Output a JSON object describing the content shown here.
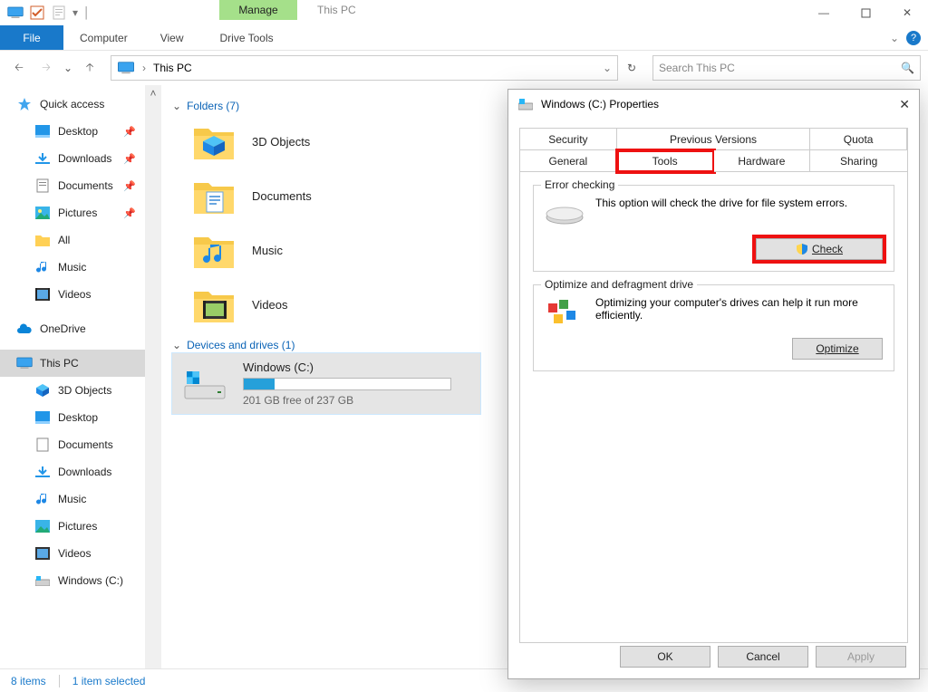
{
  "titlebar": {
    "title": "This PC",
    "context_tab": "Manage"
  },
  "ribbon": {
    "file": "File",
    "tabs": [
      "Computer",
      "View"
    ],
    "context_tab": "Drive Tools"
  },
  "address": {
    "location": "This PC"
  },
  "search": {
    "placeholder": "Search This PC"
  },
  "nav": {
    "quick_access": "Quick access",
    "qa_items": [
      {
        "label": "Desktop"
      },
      {
        "label": "Downloads"
      },
      {
        "label": "Documents"
      },
      {
        "label": "Pictures"
      },
      {
        "label": "All"
      },
      {
        "label": "Music"
      },
      {
        "label": "Videos"
      }
    ],
    "onedrive": "OneDrive",
    "this_pc": "This PC",
    "pc_items": [
      {
        "label": "3D Objects"
      },
      {
        "label": "Desktop"
      },
      {
        "label": "Documents"
      },
      {
        "label": "Downloads"
      },
      {
        "label": "Music"
      },
      {
        "label": "Pictures"
      },
      {
        "label": "Videos"
      },
      {
        "label": "Windows (C:)"
      }
    ]
  },
  "content": {
    "folders_header": "Folders (7)",
    "folders": [
      {
        "label": "3D Objects"
      },
      {
        "label": "Documents"
      },
      {
        "label": "Music"
      },
      {
        "label": "Videos"
      }
    ],
    "devices_header": "Devices and drives (1)",
    "drive": {
      "name": "Windows (C:)",
      "status": "201 GB free of 237 GB",
      "used_pct": 15
    }
  },
  "statusbar": {
    "count": "8 items",
    "selected": "1 item selected"
  },
  "dialog": {
    "title": "Windows (C:) Properties",
    "tabs_top": [
      "Security",
      "Previous Versions",
      "Quota"
    ],
    "tabs_bot": [
      "General",
      "Tools",
      "Hardware",
      "Sharing"
    ],
    "selected_tab": "Tools",
    "error_group": {
      "legend": "Error checking",
      "text": "This option will check the drive for file system errors.",
      "button": "Check"
    },
    "opt_group": {
      "legend": "Optimize and defragment drive",
      "text": "Optimizing your computer's drives can help it run more efficiently.",
      "button": "Optimize"
    },
    "buttons": {
      "ok": "OK",
      "cancel": "Cancel",
      "apply": "Apply"
    }
  }
}
